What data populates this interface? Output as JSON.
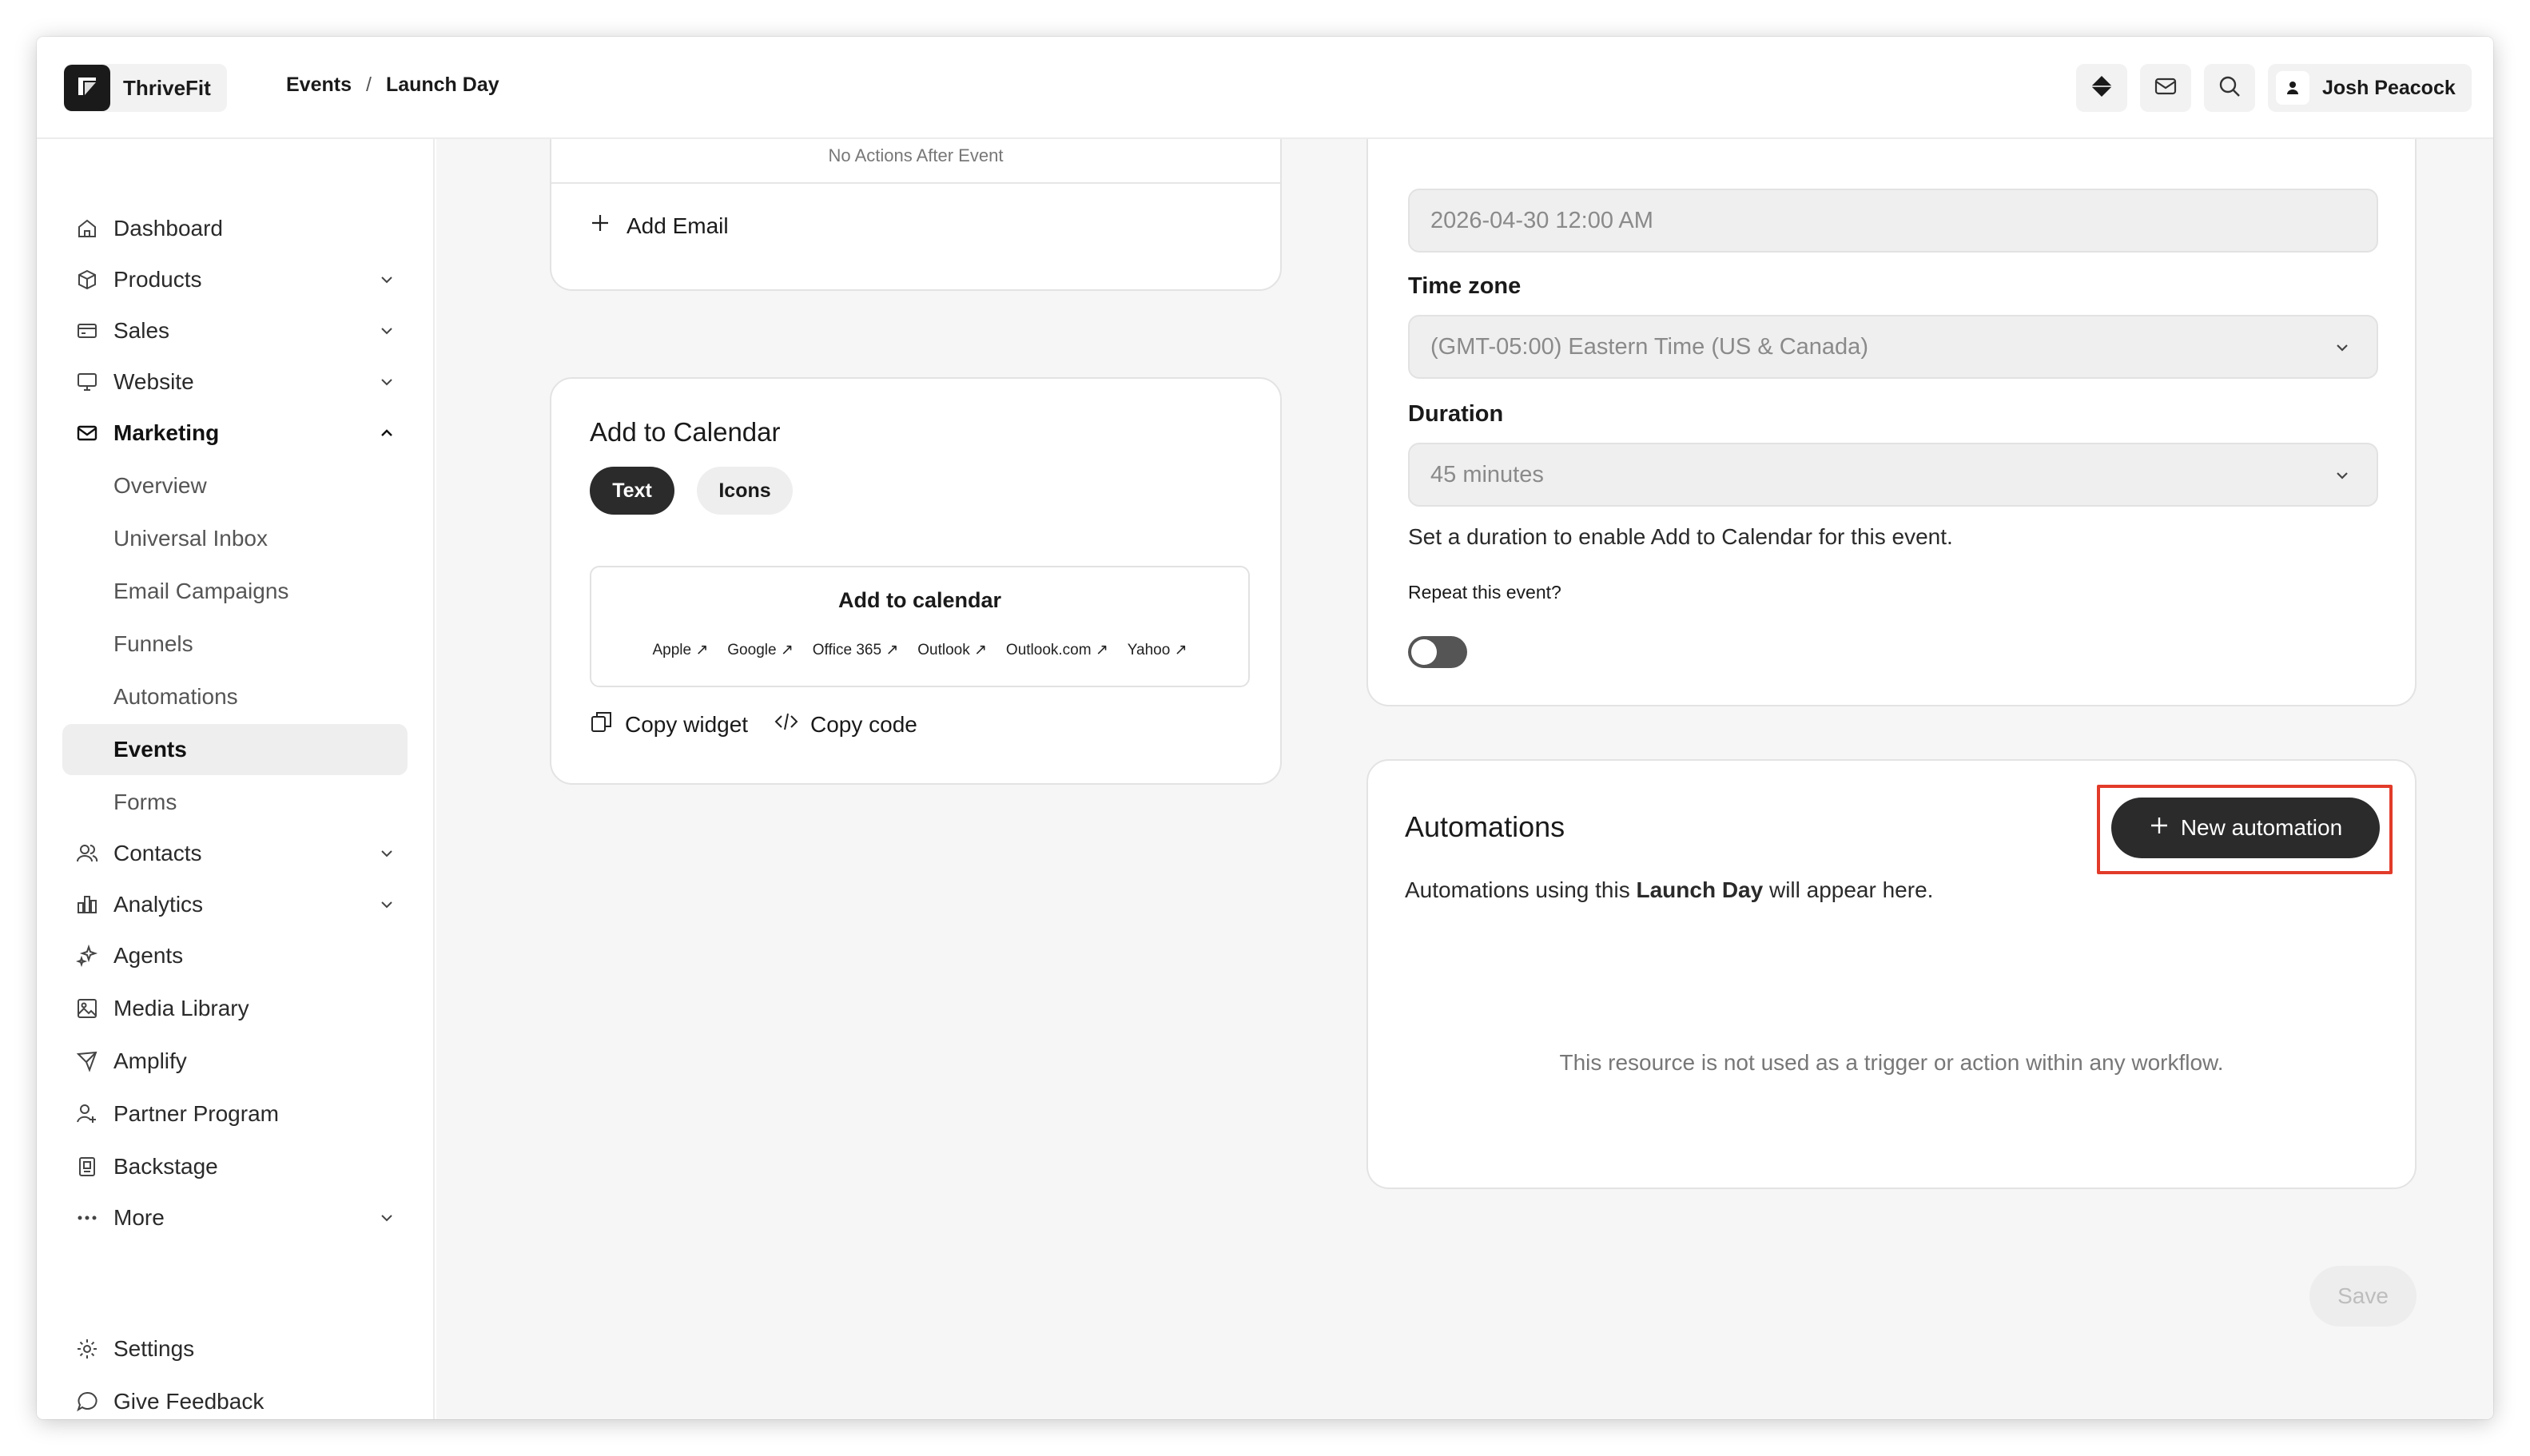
{
  "header": {
    "brand": "ThriveFit",
    "breadcrumb": [
      "Events",
      "Launch Day"
    ],
    "breadcrumb_sep": "/",
    "user_name": "Josh Peacock",
    "icons": [
      "diamond-icon",
      "mail-icon",
      "search-icon",
      "user-icon"
    ]
  },
  "sidebar": {
    "items": [
      {
        "label": "Dashboard",
        "icon": "home-icon"
      },
      {
        "label": "Products",
        "icon": "box-icon",
        "expandable": true
      },
      {
        "label": "Sales",
        "icon": "card-icon",
        "expandable": true
      },
      {
        "label": "Website",
        "icon": "monitor-icon",
        "expandable": true
      },
      {
        "label": "Marketing",
        "icon": "mail-icon",
        "expanded": true
      },
      {
        "label": "Contacts",
        "icon": "users-icon",
        "expandable": true
      },
      {
        "label": "Analytics",
        "icon": "chart-icon",
        "expandable": true
      },
      {
        "label": "Agents",
        "icon": "sparkle-icon"
      },
      {
        "label": "Media Library",
        "icon": "image-icon"
      },
      {
        "label": "Amplify",
        "icon": "send-icon"
      },
      {
        "label": "Partner Program",
        "icon": "person-plus-icon"
      },
      {
        "label": "Backstage",
        "icon": "backstage-icon"
      },
      {
        "label": "More",
        "icon": "dots-icon",
        "expandable": true
      }
    ],
    "marketing_sub": [
      "Overview",
      "Universal Inbox",
      "Email Campaigns",
      "Funnels",
      "Automations",
      "Events",
      "Forms"
    ],
    "active_sub": "Events",
    "footer": [
      {
        "label": "Settings",
        "icon": "gear-icon"
      },
      {
        "label": "Give Feedback",
        "icon": "chat-icon"
      }
    ]
  },
  "email_card": {
    "no_actions_text": "No Actions After Event",
    "add_email": "Add Email"
  },
  "calendar_card": {
    "title": "Add to Calendar",
    "toggle_text": "Text",
    "toggle_icons": "Icons",
    "preview_title": "Add to calendar",
    "providers": [
      "Apple",
      "Google",
      "Office 365",
      "Outlook",
      "Outlook.com",
      "Yahoo"
    ],
    "copy_widget": "Copy widget",
    "copy_code": "Copy code"
  },
  "settings_card": {
    "end_value": "2026-04-30 12:00 AM",
    "timezone_label": "Time zone",
    "timezone_value": "(GMT-05:00) Eastern Time (US & Canada)",
    "duration_label": "Duration",
    "duration_value": "45 minutes",
    "duration_hint": "Set a duration to enable Add to Calendar for this event.",
    "repeat_label": "Repeat this event?",
    "repeat_on": false
  },
  "automations_card": {
    "title": "Automations",
    "new_button": "New automation",
    "desc_prefix": "Automations using this ",
    "desc_bold": "Launch Day",
    "desc_suffix": " will appear here.",
    "empty": "This resource is not used as a trigger or action within any workflow."
  },
  "save_label": "Save",
  "colors": {
    "dark": "#2b2b2b",
    "highlight": "#e23b2a",
    "bg": "#f6f6f6"
  }
}
